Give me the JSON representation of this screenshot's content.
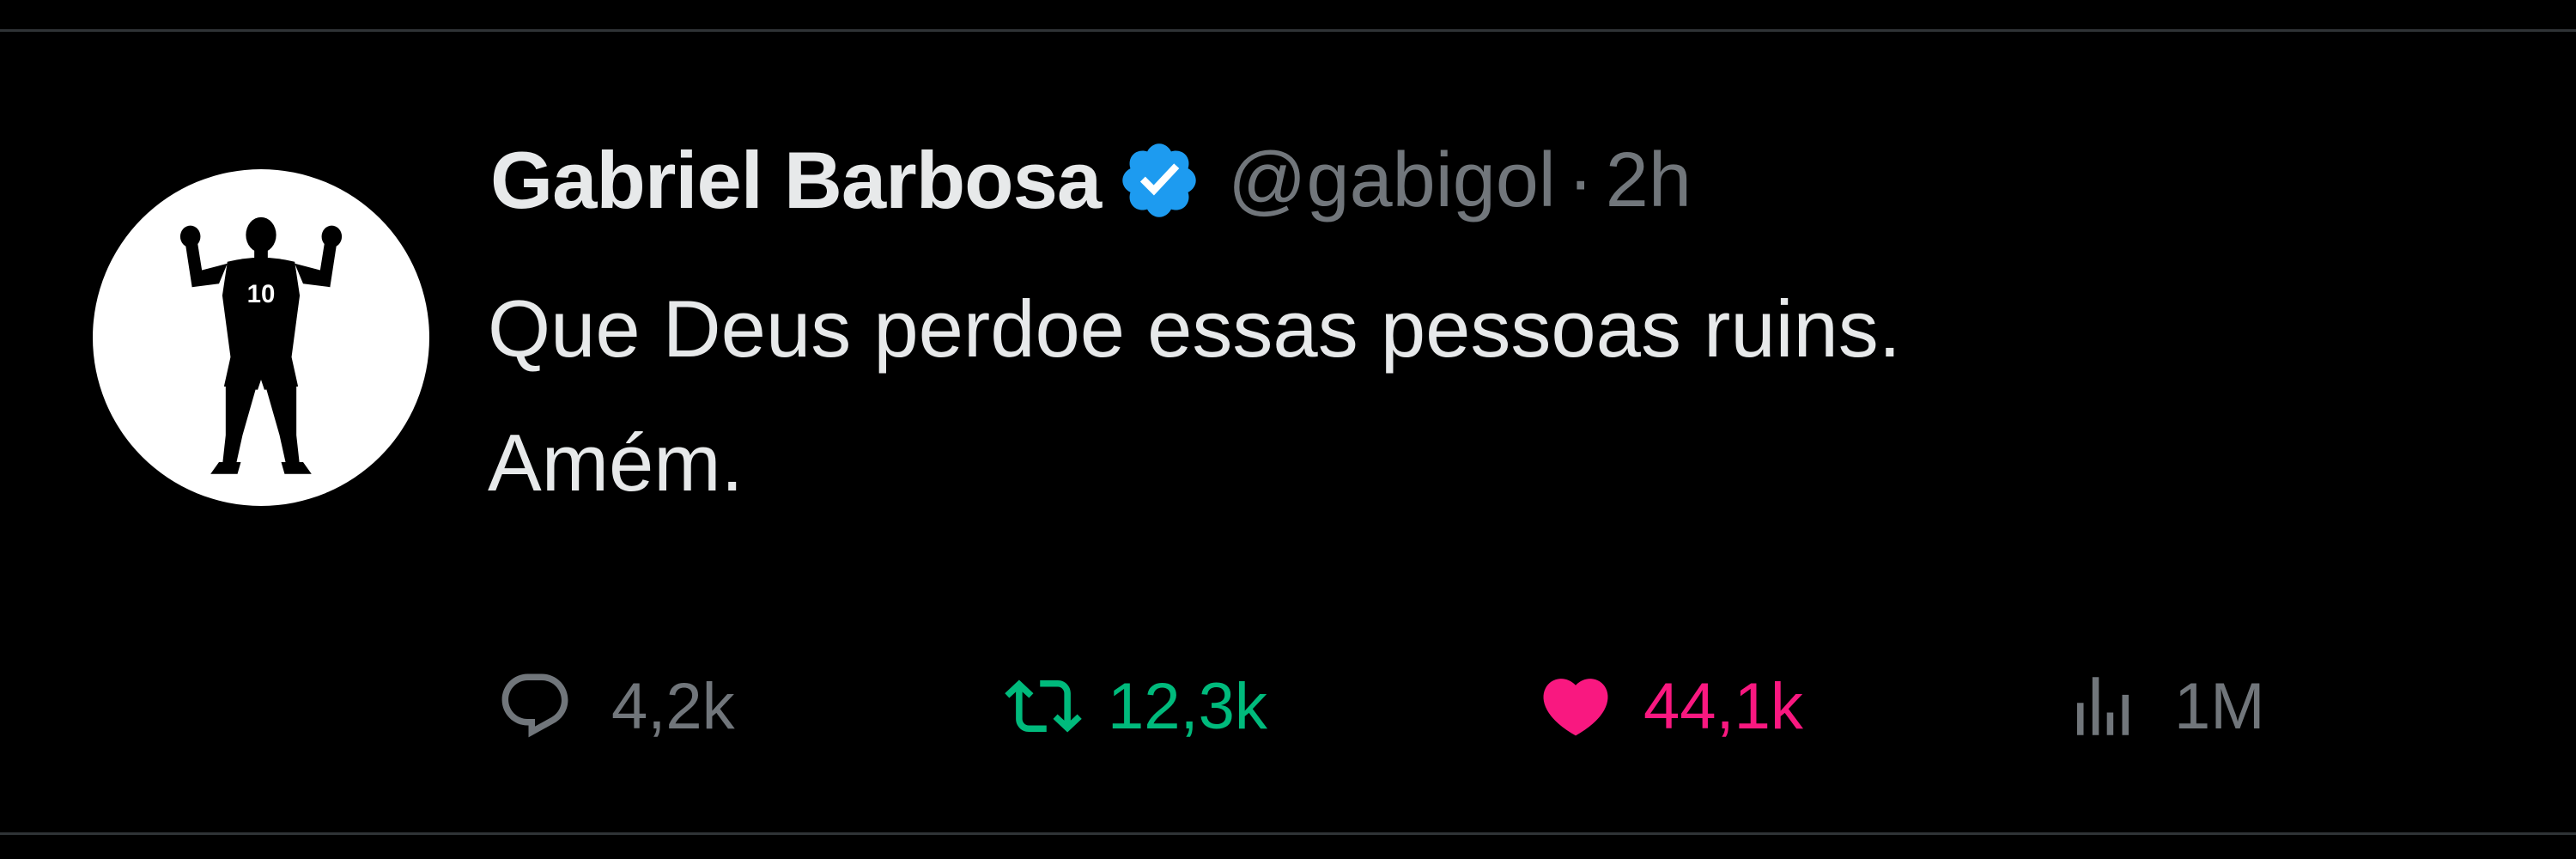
{
  "tweet": {
    "author": {
      "name": "Gabriel Barbosa",
      "handle": "@gabigol",
      "verified": true,
      "avatar_jersey_number": "10"
    },
    "separator": "·",
    "time": "2h",
    "text_lines": [
      "Que Deus perdoe essas pessoas ruins.",
      "Amém."
    ],
    "actions": {
      "replies": "4,2k",
      "retweets": "12,3k",
      "likes": "44,1k",
      "views": "1M"
    },
    "liked": true
  },
  "colors": {
    "background": "#000000",
    "primary_text": "#e7e9ea",
    "secondary_text": "#71767b",
    "verified_blue": "#1d9bf0",
    "retweet_green": "#00ba7c",
    "like_pink": "#f91880"
  },
  "icons": {
    "reply": "speech-bubble-icon",
    "retweet": "retweet-arrows-icon",
    "like": "heart-icon",
    "views": "bar-chart-icon",
    "verified": "verified-badge-icon"
  }
}
